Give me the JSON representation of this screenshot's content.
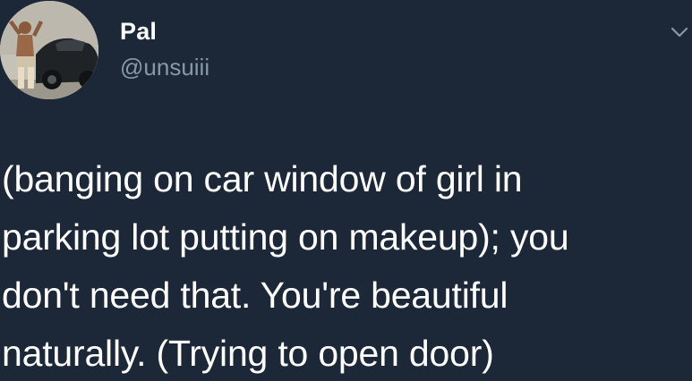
{
  "tweet": {
    "author": {
      "display_name": "Pal",
      "handle": "@unsuiii",
      "avatar_icon": "avatar-photo"
    },
    "menu_icon": "chevron-down-icon",
    "text": "(banging on car window of girl in\nparking lot putting on makeup); you\ndon't need that. You're beautiful\nnaturally. (Trying to open door)"
  },
  "colors": {
    "background": "#1c2838",
    "text": "#ffffff",
    "secondary_text": "#8899a6"
  }
}
